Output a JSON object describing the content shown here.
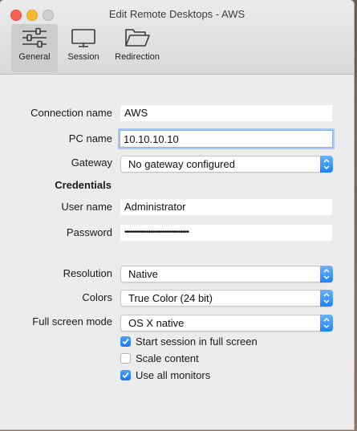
{
  "window": {
    "title": "Edit Remote Desktops - AWS"
  },
  "tabs": [
    {
      "label": "General",
      "icon": "sliders-icon",
      "active": true
    },
    {
      "label": "Session",
      "icon": "monitor-icon",
      "active": false
    },
    {
      "label": "Redirection",
      "icon": "folder-icon",
      "active": false
    }
  ],
  "form": {
    "connection_name": {
      "label": "Connection name",
      "value": "AWS"
    },
    "pc_name": {
      "label": "PC name",
      "value": "10.10.10.10"
    },
    "gateway": {
      "label": "Gateway",
      "value": "No gateway configured"
    },
    "credentials_heading": "Credentials",
    "user_name": {
      "label": "User name",
      "value": "Administrator"
    },
    "password": {
      "label": "Password",
      "value": "••••••••••••••••••••••••••••••••"
    },
    "resolution": {
      "label": "Resolution",
      "value": "Native"
    },
    "colors": {
      "label": "Colors",
      "value": "True Color (24 bit)"
    },
    "full_screen_mode": {
      "label": "Full screen mode",
      "value": "OS X native"
    },
    "checkboxes": [
      {
        "label": "Start session in full screen",
        "checked": true
      },
      {
        "label": "Scale content",
        "checked": false
      },
      {
        "label": "Use all monitors",
        "checked": true
      }
    ]
  },
  "colors": {
    "accent": "#1a82fb",
    "focus_ring": "#a8c6f5"
  }
}
